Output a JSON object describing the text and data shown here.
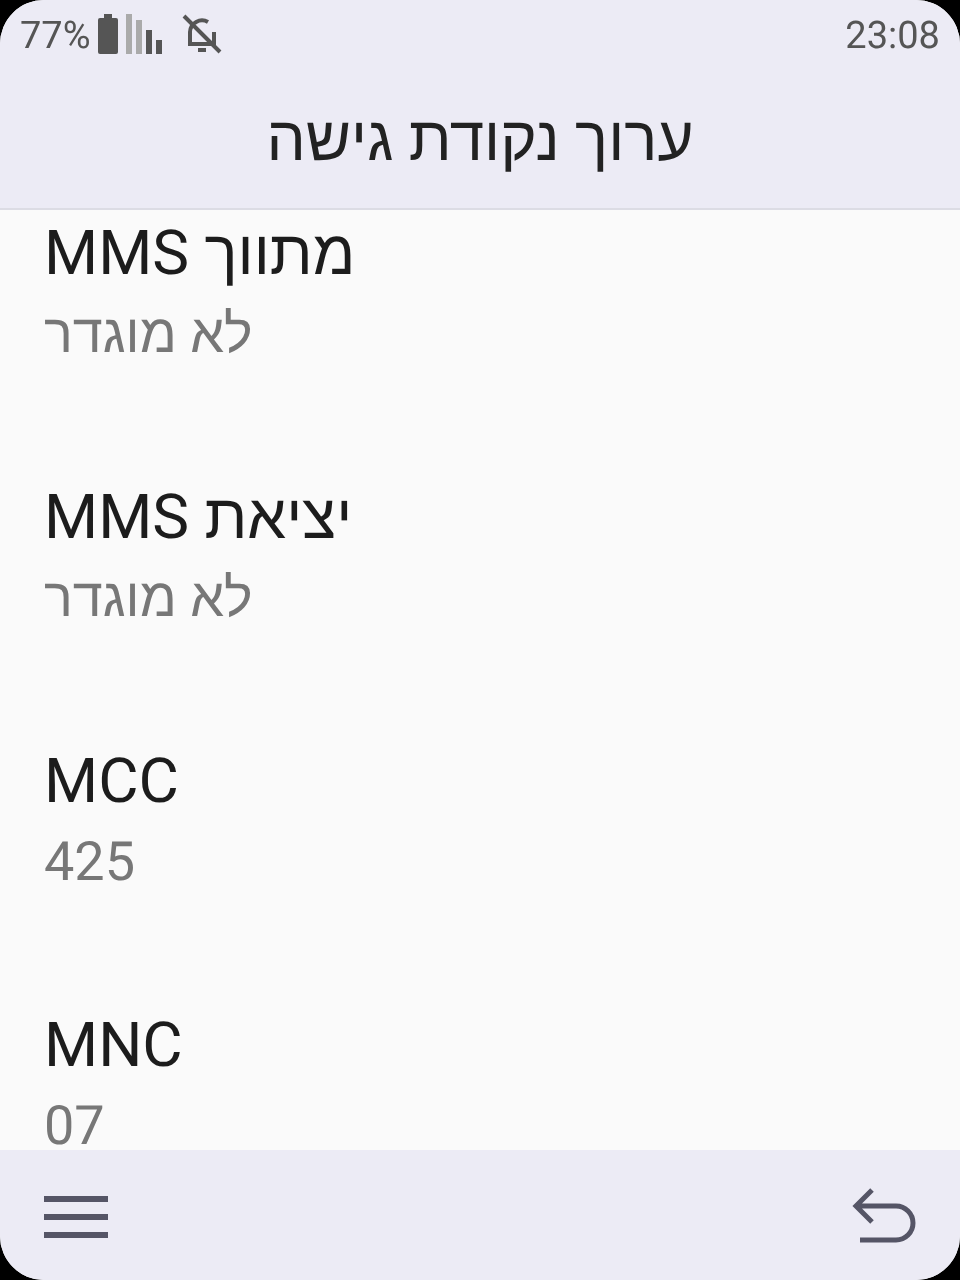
{
  "status_bar": {
    "battery": "77%",
    "time": "23:08"
  },
  "title": "ערוך נקודת גישה",
  "settings": [
    {
      "title": "מתווך MMS",
      "value": "לא מוגדר"
    },
    {
      "title": "יציאת MMS",
      "value": "לא מוגדר"
    },
    {
      "title": "MCC",
      "value": "425"
    },
    {
      "title": "MNC",
      "value": "07"
    }
  ]
}
